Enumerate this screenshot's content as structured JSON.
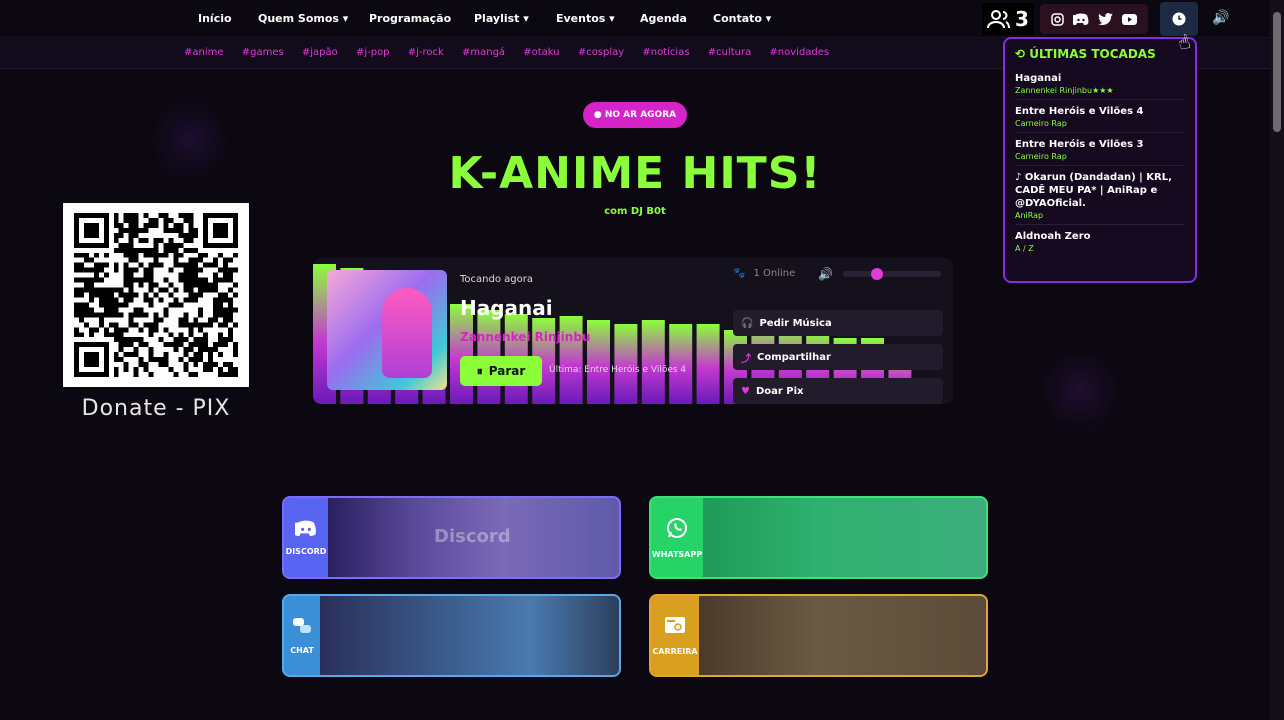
{
  "nav": {
    "items": [
      "Início",
      "Quem Somos ▾",
      "Programação",
      "Playlist ▾",
      "Eventos ▾",
      "Agenda",
      "Contato ▾"
    ]
  },
  "tags": [
    "#anime",
    "#games",
    "#japão",
    "#j-pop",
    "#j-rock",
    "#mangá",
    "#otaku",
    "#cosplay",
    "#notícias",
    "#cultura",
    "#novidades"
  ],
  "header": {
    "listeners_count": "3"
  },
  "recent": {
    "title": "ÚLTIMAS TOCADAS",
    "items": [
      {
        "song": "Haganai",
        "artist": "Zannenkei Rinjinbu★★★"
      },
      {
        "song": "Entre Heróis e Vilões 4",
        "artist": "Carneiro Rap"
      },
      {
        "song": "Entre Heróis e Vilões 3",
        "artist": "Carneiro Rap"
      },
      {
        "song": "♪ Okarun (Dandadan) | KRL, CADÊ MEU PA* | AniRap e @DYAOficial.",
        "artist": "AniRap"
      },
      {
        "song": "Aldnoah Zero",
        "artist": "A / Z"
      }
    ]
  },
  "hero": {
    "live_badge": "● NO AR AGORA",
    "title": "K-ANIME HITS!",
    "subtitle": "com DJ B0t"
  },
  "donate": {
    "label": "Donate - PIX"
  },
  "player": {
    "now_playing_label": "Tocando agora",
    "song": "Haganai",
    "artist": "Zannenkei Rinjinbu",
    "stop_label": "Parar",
    "last_played": "Última: Entre Heróis e Vilões 4",
    "online": "1 Online",
    "volume_level": 0.35,
    "request_label": "Pedir Música",
    "share_label": "Compartilhar",
    "donate_label": "Doar Pix"
  },
  "cards": {
    "discord": {
      "label": "DISCORD",
      "word": "Discord",
      "color": "#5865f2"
    },
    "whatsapp": {
      "label": "WHATSAPP",
      "color": "#25d366"
    },
    "chat": {
      "label": "CHAT",
      "color": "#3b8fd6"
    },
    "career": {
      "label": "CARREIRA",
      "color": "#d9a020"
    }
  },
  "colors": {
    "accent_green": "#8aff3a",
    "accent_pink": "#d624c8",
    "accent_purple": "#8a2be2",
    "background": "#0b0812"
  }
}
